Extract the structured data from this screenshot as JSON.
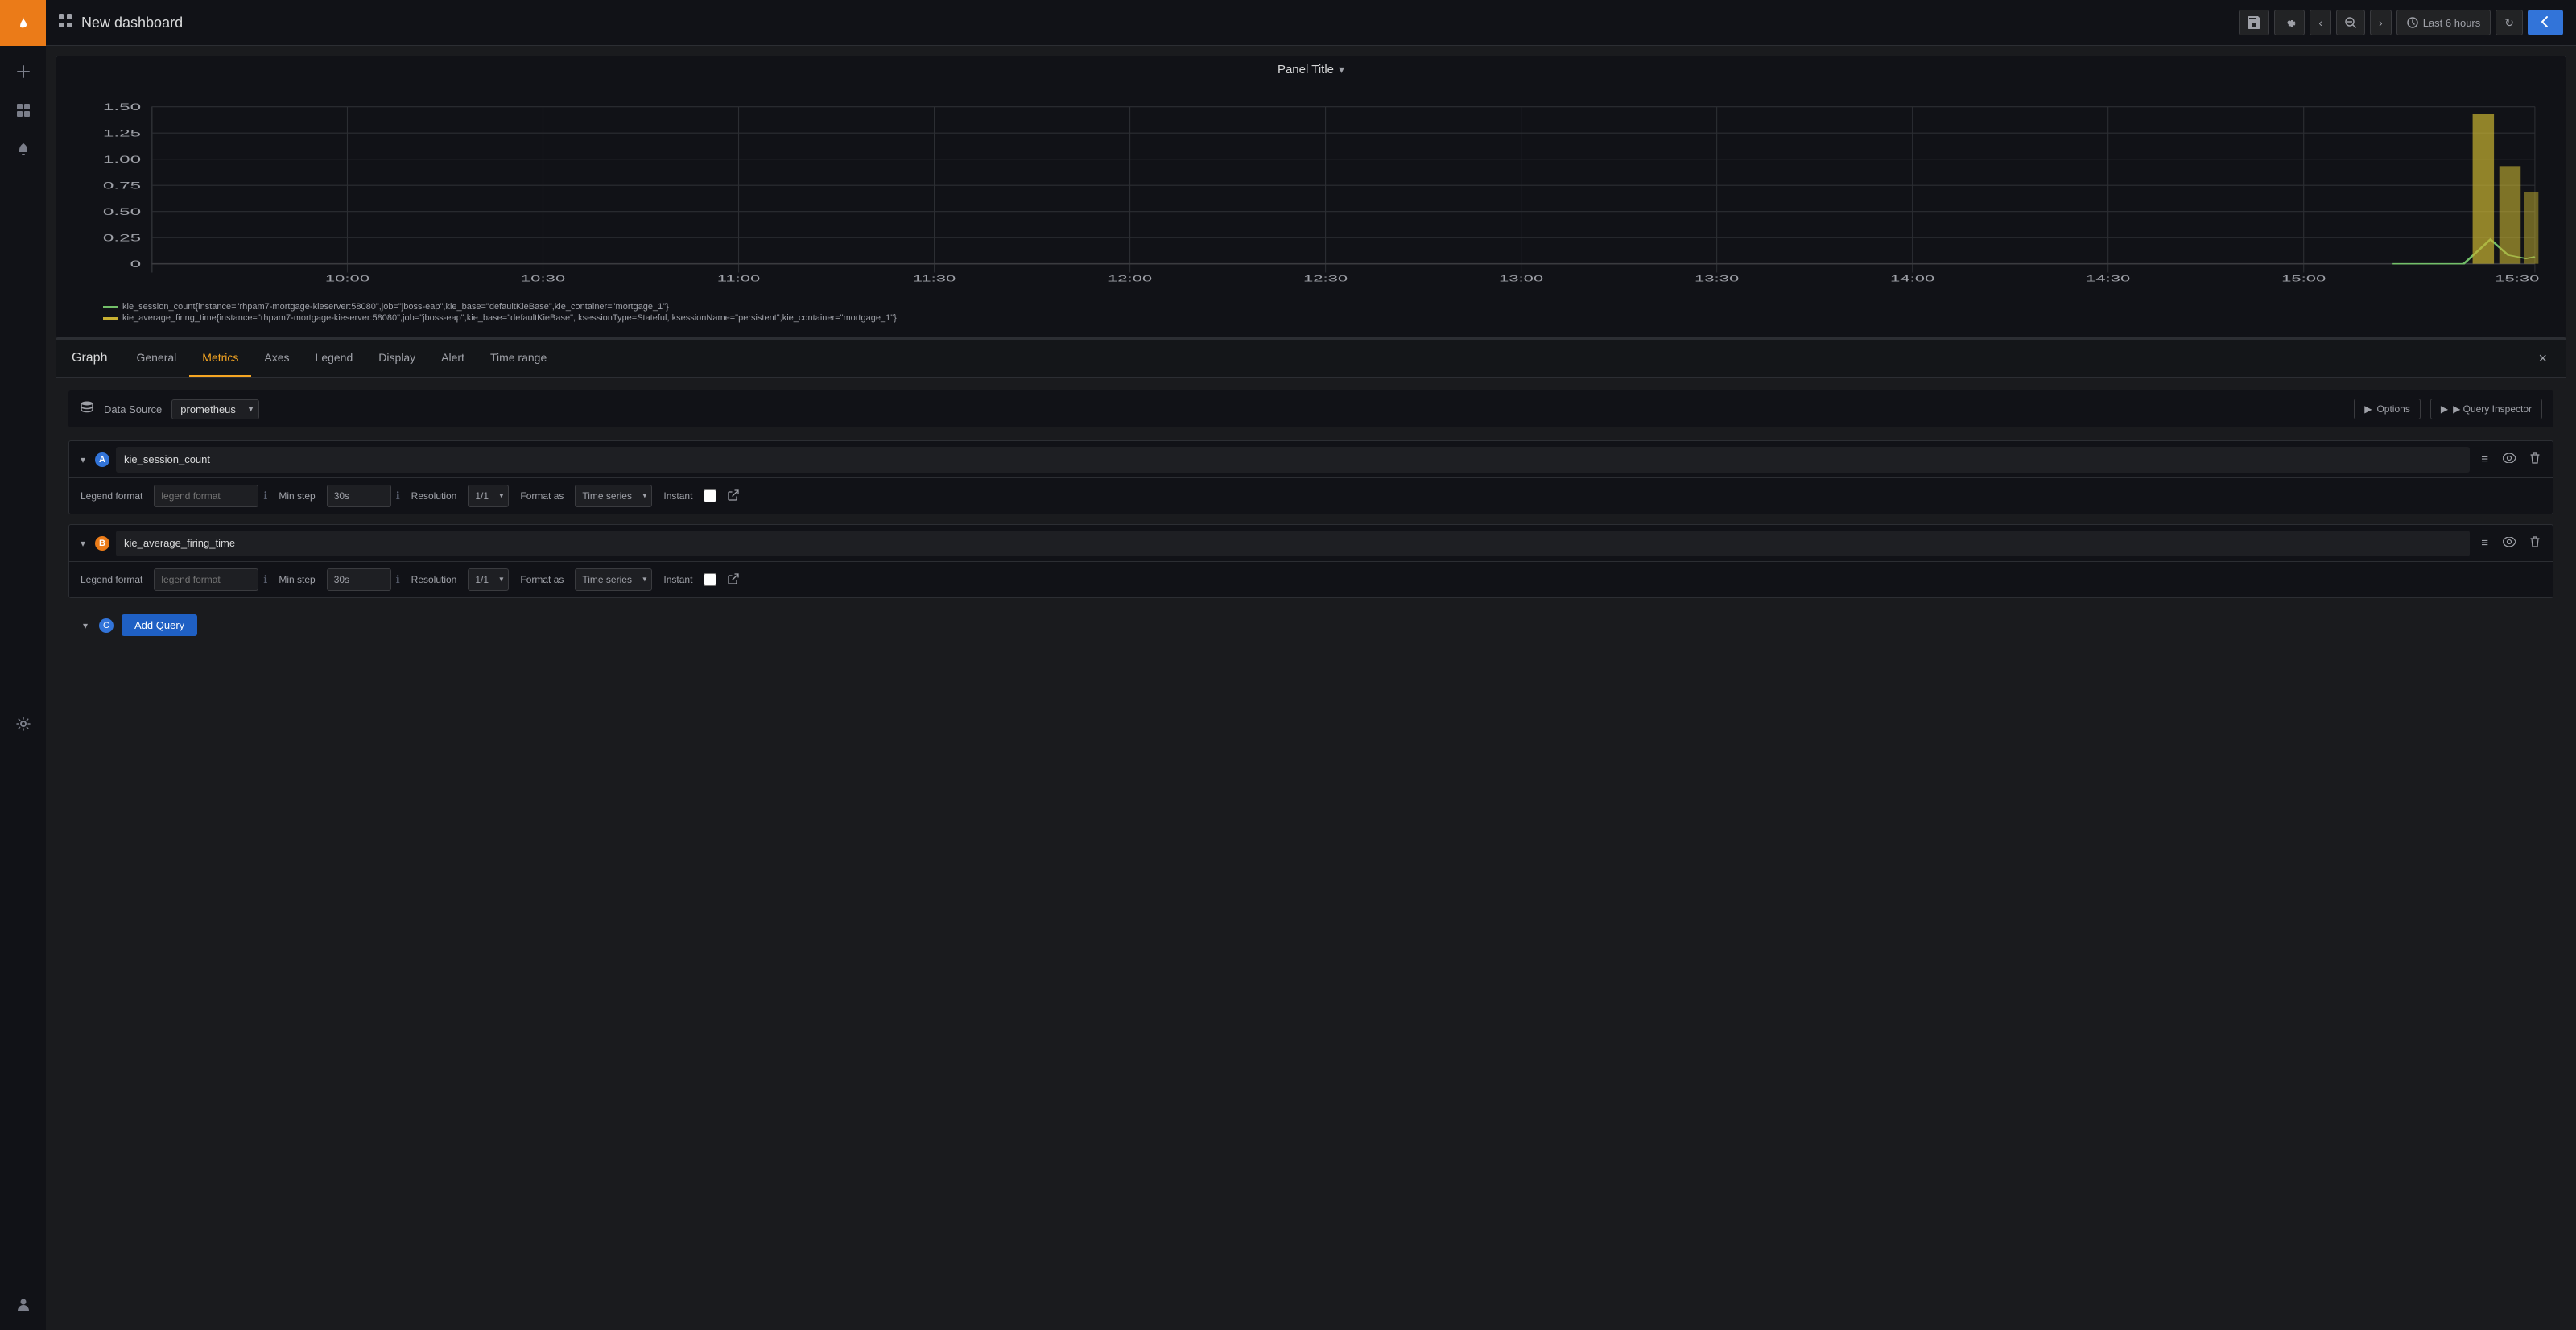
{
  "sidebar": {
    "logo_icon": "fire-icon",
    "items": [
      {
        "icon": "plus-icon",
        "label": "Add",
        "unicode": "+"
      },
      {
        "icon": "grid-icon",
        "label": "Dashboard",
        "unicode": "⊞"
      },
      {
        "icon": "bell-icon",
        "label": "Alerts",
        "unicode": "🔔"
      },
      {
        "icon": "gear-icon",
        "label": "Settings",
        "unicode": "⚙"
      }
    ],
    "bottom": [
      {
        "icon": "user-icon",
        "label": "User",
        "unicode": "👤"
      }
    ]
  },
  "topbar": {
    "grid_icon": "⊞",
    "title": "New dashboard",
    "save_btn": "💾",
    "settings_btn": "⚙",
    "nav_left": "‹",
    "zoom_btn": "⊖",
    "nav_right": "›",
    "time_label": "Last 6 hours",
    "refresh_btn": "↻",
    "back_btn": "↩"
  },
  "panel": {
    "title": "Panel Title",
    "legend": [
      {
        "color": "#73bf69",
        "text": "kie_session_count{instance=\"rhpam7-mortgage-kieserver:58080\",job=\"jboss-eap\",kie_base=\"defaultKieBase\",kie_container=\"mortgage_1\"}"
      },
      {
        "color": "#c8b032",
        "text": "kie_average_firing_time{instance=\"rhpam7-mortgage-kieserver:58080\",job=\"jboss-eap\",kie_base=\"defaultKieBase\", ksessionType=Stateful, ksessionName=\"persistent\",kie_container=\"mortgage_1\"}"
      }
    ],
    "y_labels": [
      "1.50",
      "1.25",
      "1.00",
      "0.75",
      "0.50",
      "0.25",
      "0"
    ],
    "x_labels": [
      "10:00",
      "10:30",
      "11:00",
      "11:30",
      "12:00",
      "12:30",
      "13:00",
      "13:30",
      "14:00",
      "14:30",
      "15:00",
      "15:30"
    ]
  },
  "edit": {
    "panel_name": "Graph",
    "tabs": [
      "General",
      "Metrics",
      "Axes",
      "Legend",
      "Display",
      "Alert",
      "Time range"
    ],
    "active_tab": "Metrics",
    "close_btn": "×"
  },
  "datasource": {
    "label": "Data Source",
    "value": "prometheus",
    "options_btn": "▶ Options",
    "query_inspector_btn": "▶ Query Inspector"
  },
  "queries": [
    {
      "id": "A",
      "value": "kie_session_count",
      "legend_format_placeholder": "legend format",
      "legend_format_label": "Legend format",
      "min_step_label": "Min step",
      "min_step_value": "30s",
      "resolution_label": "Resolution",
      "resolution_value": "1/1",
      "format_as_label": "Format as",
      "format_as_value": "Time series",
      "instant_label": "Instant"
    },
    {
      "id": "B",
      "value": "kie_average_firing_time",
      "legend_format_placeholder": "legend format",
      "legend_format_label": "Legend format",
      "min_step_label": "Min step",
      "min_step_value": "30s",
      "resolution_label": "Resolution",
      "resolution_value": "1/1",
      "format_as_label": "Format as",
      "format_as_value": "Time series",
      "instant_label": "Instant"
    }
  ],
  "add_query": {
    "id": "C",
    "label": "Add Query"
  }
}
